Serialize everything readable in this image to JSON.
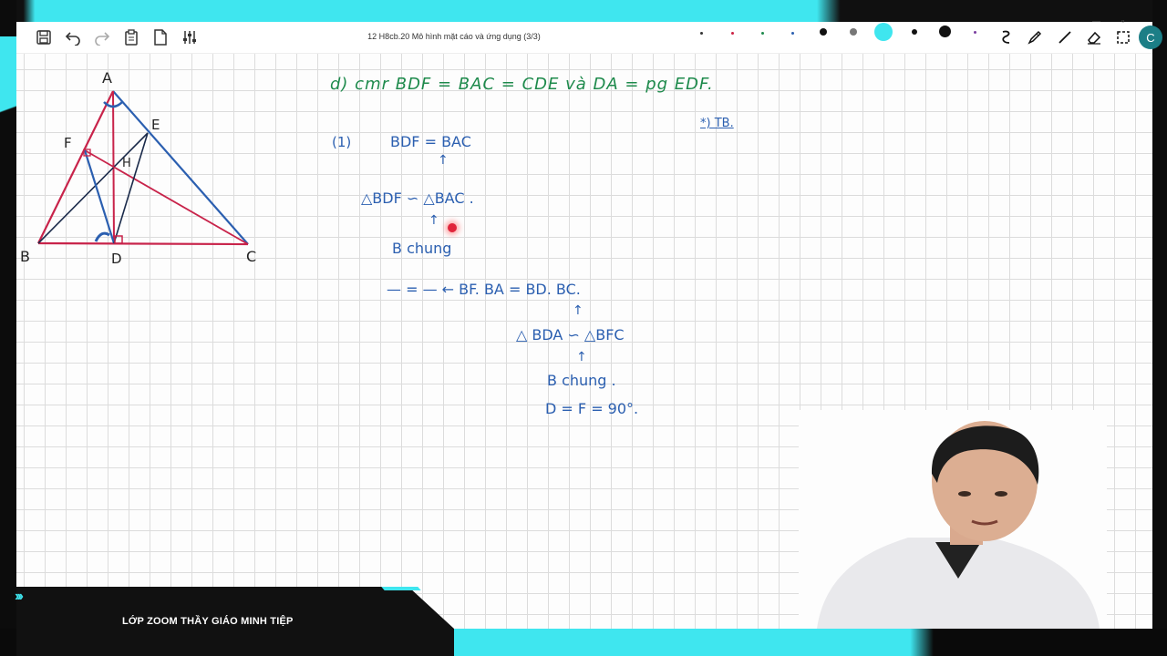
{
  "toolbar": {
    "title": "12 H8cb.20 Mô hình mặt cáo và ứng dụng (3/3)",
    "buttons": [
      "save-icon",
      "undo-icon",
      "redo-icon",
      "clipboard-icon",
      "new-page-icon",
      "settings-sliders-icon"
    ],
    "tools": [
      "lasso-icon",
      "pen-icon",
      "line-icon",
      "eraser-icon",
      "select-icon"
    ],
    "window_controls": [
      "—",
      "▫"
    ],
    "avatar_letter": "C",
    "pen_colors": [
      "#333333",
      "#cc2244",
      "#1e8a4c",
      "#2b5fb0",
      "#111111",
      "#777777",
      "#3fe6ef",
      "#111111",
      "#111111",
      "#7b3fa0"
    ]
  },
  "figure": {
    "vertices": {
      "A": "A",
      "B": "B",
      "C": "C",
      "D": "D",
      "E": "E",
      "F": "F",
      "H": "H"
    }
  },
  "notes": {
    "line1": "d) cmr BDF = BAC = CDE và DA = pg EDF.",
    "line_bullet": "(1)",
    "line2": "BDF = BAC",
    "arrow1": "↑",
    "line3": "△BDF ∽ △BAC .",
    "arrow2": "↑",
    "line4": "B chung",
    "line5": "— = —  ←  BF. BA = BD. BC.",
    "arrow3": "↑",
    "line6": "△ BDA ∽ △BFC",
    "arrow4": "↑",
    "line7": "B chung .",
    "line8": "D = F = 90°.",
    "side_note": "*) TB."
  },
  "footer": {
    "arrows": "›››",
    "caption": "LỚP ZOOM THẦY GIÁO MINH TIỆP"
  }
}
